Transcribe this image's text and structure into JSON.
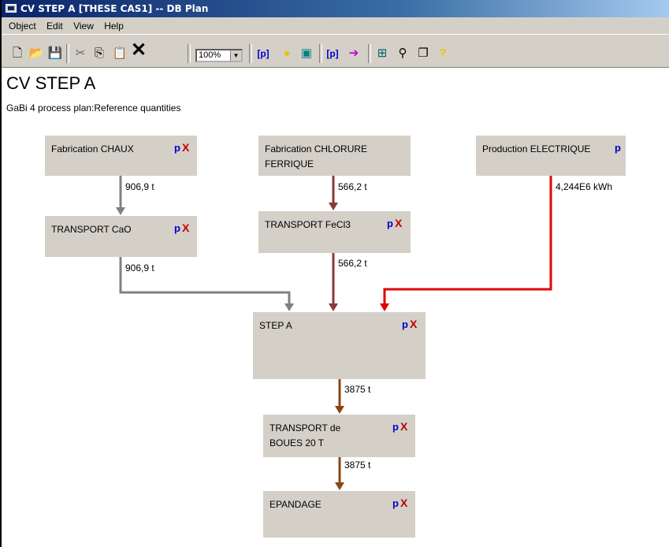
{
  "window": {
    "title": "CV STEP A [THESE CAS1] -- DB Plan"
  },
  "menu": [
    "Object",
    "Edit",
    "View",
    "Help"
  ],
  "toolbar": {
    "zoom": "100%"
  },
  "plan": {
    "title": "CV STEP A",
    "subtitle": "GaBi 4 process plan:Reference quantities"
  },
  "processes": {
    "chaux": {
      "name": "Fabrication CHAUX",
      "p": "p",
      "x": "X"
    },
    "chlorure": {
      "name1": "Fabrication CHLORURE",
      "name2": "FERRIQUE"
    },
    "elec": {
      "name": "Production ELECTRIQUE",
      "p": "p"
    },
    "cao": {
      "name": "TRANSPORT CaO",
      "p": "p",
      "x": "X"
    },
    "fecl3": {
      "name": "TRANSPORT FeCl3",
      "p": "p",
      "x": "X"
    },
    "stepa": {
      "name": "STEP A",
      "p": "p",
      "x": "X"
    },
    "boues": {
      "name1": "TRANSPORT de",
      "name2": "BOUES 20 T",
      "p": "p",
      "x": "X"
    },
    "epandage": {
      "name": "EPANDAGE",
      "p": "p",
      "x": "X"
    }
  },
  "flows": {
    "chaux_cao": "906,9 t",
    "chlorure_fecl3": "566,2 t",
    "elec_step": "4,244E6 kWh",
    "cao_step": "906,9 t",
    "fecl3_step": "566,2 t",
    "step_boues": "3875 t",
    "boues_epandage": "3875 t"
  },
  "colors": {
    "lime_flow": "#808080",
    "fecl3_flow": "#8b3a3a",
    "elec_flow": "#e00000",
    "boues_flow": "#8b4513"
  }
}
